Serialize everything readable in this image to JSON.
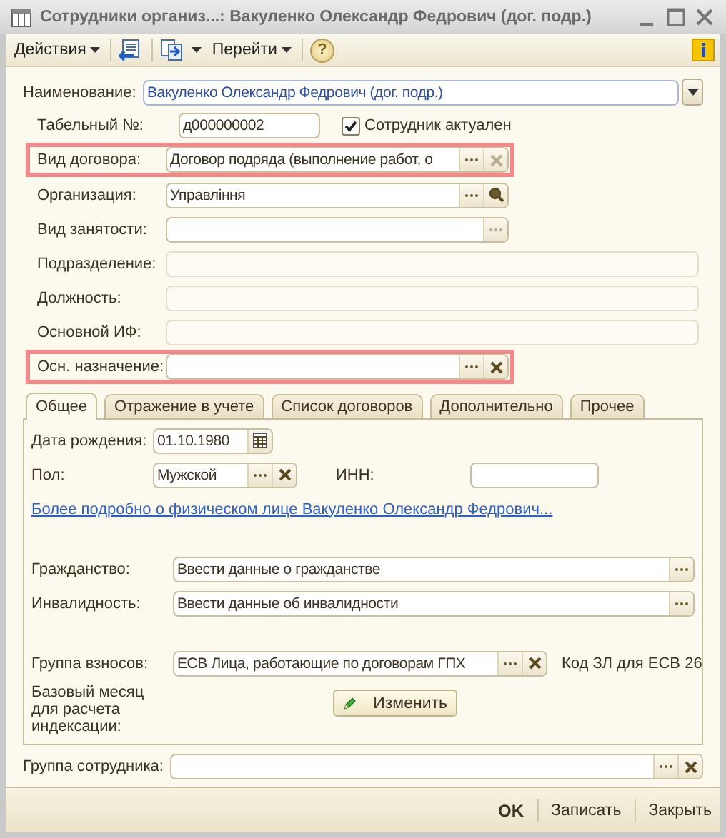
{
  "window": {
    "title": "Сотрудники организ...: Вакуленко Олександр Федрович  (дог. подр.)"
  },
  "toolbar": {
    "actions_menu": "Действия",
    "goto_menu": "Перейти",
    "help": "?"
  },
  "name": {
    "label": "Наименование:",
    "value": "Вакуленко Олександр Федрович  (дог. подр.)"
  },
  "tab_number": {
    "label": "Табельный №:",
    "value": "д000000002"
  },
  "active_checkbox": {
    "label": "Сотрудник актуален",
    "checked": true
  },
  "fields": [
    {
      "label": "Вид договора:",
      "value": "Договор подряда (выполнение работ, о",
      "highlighted": true,
      "disabled": false,
      "buttons": [
        {
          "kind": "select",
          "disabled": false
        },
        {
          "kind": "clear",
          "disabled": true
        }
      ]
    },
    {
      "label": "Организация:",
      "value": "Управління",
      "highlighted": false,
      "disabled": false,
      "buttons": [
        {
          "kind": "select",
          "disabled": false
        },
        {
          "kind": "search",
          "disabled": false
        }
      ]
    },
    {
      "label": "Вид занятости:",
      "highlighted": false,
      "disabled": false,
      "buttons": [
        {
          "kind": "select",
          "disabled": true
        }
      ]
    },
    {
      "label": "Подразделение:",
      "highlighted": false,
      "disabled": true
    },
    {
      "label": "Должность:",
      "highlighted": false,
      "disabled": true
    },
    {
      "label": "Основной ИФ:",
      "highlighted": false,
      "disabled": true
    },
    {
      "label": "Осн. назначение:",
      "highlighted": true,
      "disabled": false,
      "buttons": [
        {
          "kind": "select",
          "disabled": false
        },
        {
          "kind": "clear",
          "disabled": false
        }
      ]
    }
  ],
  "tabs": [
    {
      "label": "Общее",
      "selected": true
    },
    {
      "label": "Отражение в учете",
      "selected": false
    },
    {
      "label": "Список договоров",
      "selected": false
    },
    {
      "label": "Дополнительно",
      "selected": false
    },
    {
      "label": "Прочее",
      "selected": false
    }
  ],
  "general": {
    "birth_date": {
      "label": "Дата рождения:",
      "value": "01.10.1980"
    },
    "gender": {
      "label": "Пол:",
      "value": "Мужской"
    },
    "inn": {
      "label": "ИНН:"
    },
    "person_link": "Более подробно о физическом лице Вакуленко Олександр Федрович...",
    "citizenship": {
      "label": "Гражданство:",
      "value": "Ввести данные о гражданстве"
    },
    "disability": {
      "label": "Инвалидность:",
      "value": "Ввести данные об инвалидности"
    },
    "contribution_group": {
      "label": "Группа взносов:",
      "value": "ЕСВ Лица, работающие по договорам ГПХ",
      "code": "Код ЗЛ для ЕСВ 26"
    },
    "indexation": {
      "label": "Базовый месяц для расчета индексации:",
      "button": "Изменить"
    }
  },
  "employee_group": {
    "label": "Группа сотрудника:"
  },
  "footer_buttons": [
    {
      "label": "OK",
      "default": true
    },
    {
      "label": "Записать",
      "default": false
    },
    {
      "label": "Закрыть",
      "default": false
    }
  ]
}
